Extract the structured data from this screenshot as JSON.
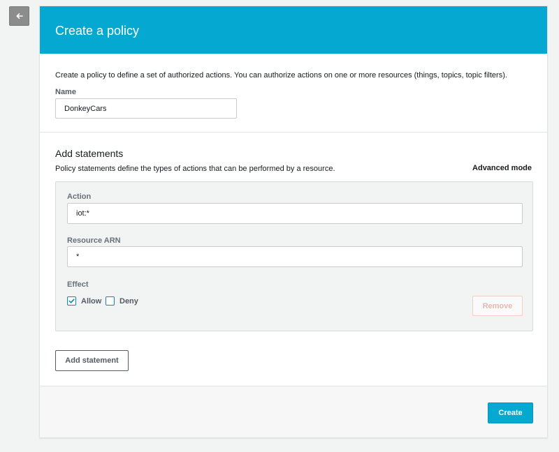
{
  "header": {
    "title": "Create a policy"
  },
  "intro": {
    "text": "Create a policy to define a set of authorized actions. You can authorize actions on one or more resources (things, topics, topic filters)."
  },
  "name_field": {
    "label": "Name",
    "value": "DonkeyCars"
  },
  "statements": {
    "title": "Add statements",
    "description": "Policy statements define the types of actions that can be performed by a resource.",
    "advanced_mode_label": "Advanced mode",
    "items": [
      {
        "action_label": "Action",
        "action_value": "iot:*",
        "resource_label": "Resource ARN",
        "resource_value": "*",
        "effect_label": "Effect",
        "effect_options": [
          {
            "label": "Allow",
            "checked": true
          },
          {
            "label": "Deny",
            "checked": false
          }
        ],
        "remove_label": "Remove"
      }
    ],
    "add_statement_label": "Add statement"
  },
  "footer": {
    "create_label": "Create"
  },
  "colors": {
    "accent": "#05a8d1",
    "background": "#f2f3f3",
    "remove_text": "#e8b8ad"
  },
  "icons": {
    "back": "arrow-left-icon",
    "allow_check": "checkmark-icon"
  }
}
